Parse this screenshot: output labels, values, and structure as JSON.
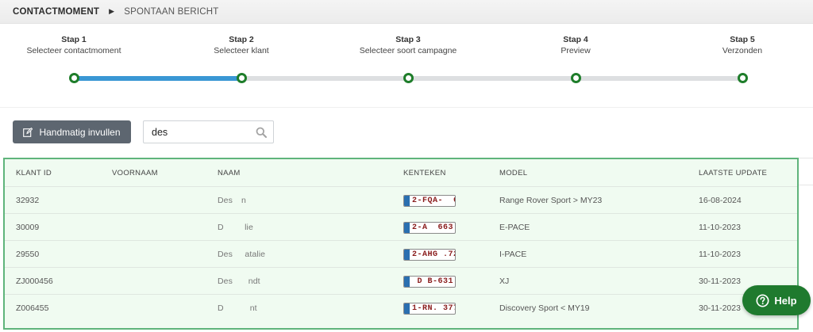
{
  "breadcrumb": {
    "items": [
      "CONTACTMOMENT",
      "SPONTAAN BERICHT"
    ]
  },
  "stepper": {
    "active_step": 2,
    "steps": [
      {
        "number": "Stap 1",
        "name": "Selecteer contactmoment"
      },
      {
        "number": "Stap 2",
        "name": "Selecteer klant"
      },
      {
        "number": "Stap 3",
        "name": "Selecteer soort campagne"
      },
      {
        "number": "Stap 4",
        "name": "Preview"
      },
      {
        "number": "Stap 5",
        "name": "Verzonden"
      }
    ]
  },
  "toolbar": {
    "manual_label": "Handmatig invullen",
    "search_value": "des"
  },
  "table": {
    "headers": {
      "id": "KLANT ID",
      "first_name": "VOORNAAM",
      "name": "NAAM",
      "plate": "KENTEKEN",
      "model": "MODEL",
      "updated": "LAATSTE UPDATE"
    },
    "rows": [
      {
        "id": "32932",
        "first_name": "",
        "name": "Des     n",
        "plate": "2-FQA-  6",
        "model": "Range Rover Sport > MY23",
        "updated": "16-08-2024"
      },
      {
        "id": "30009",
        "first_name": "",
        "name": "D            lie",
        "plate": "2-A  663",
        "model": "E-PACE",
        "updated": "11-10-2023"
      },
      {
        "id": "29550",
        "first_name": "",
        "name": "Des       atalie",
        "plate": "2-AHG .72",
        "model": "I-PACE",
        "updated": "11-10-2023"
      },
      {
        "id": "ZJ000456",
        "first_name": "",
        "name": "Des         ndt",
        "plate": " D B-631",
        "model": "XJ",
        "updated": "30-11-2023"
      },
      {
        "id": "Z006455",
        "first_name": "",
        "name": "D               nt",
        "plate": "1-RN. 377",
        "model": "Discovery Sport < MY19",
        "updated": "30-11-2023"
      }
    ]
  },
  "help": {
    "label": "Help"
  },
  "colors": {
    "accent_blue": "#3a97d4",
    "step_green": "#1e7d2a",
    "table_border": "#5fb47b",
    "help_green": "#1f7a2e"
  }
}
